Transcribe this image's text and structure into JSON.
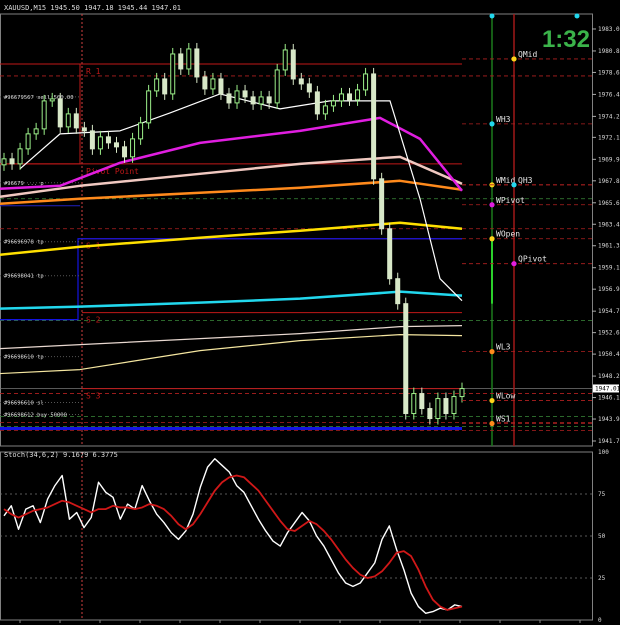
{
  "header": {
    "symbol_label": "XAUUSD,M15  1945.50 1947.18 1945.44 1947.01"
  },
  "timer": "1:32",
  "colors": {
    "up_candle": "#9cf08a",
    "down_candle": "#d8e8c8",
    "white_ma": "#ffffff",
    "magenta_ma": "#e01ee0",
    "pink_ma": "#f0c8c0",
    "orange_ma": "#ff8a1c",
    "yellow_ma": "#ffe000",
    "cyan_ma": "#22d8ee",
    "blue_line": "#1414e0",
    "pivot_red": "#c01818",
    "stoch_main": "#ffffff",
    "stoch_signal": "#d01818"
  },
  "chart_data": [
    {
      "type": "candlestick",
      "title": "XAUUSD,M15",
      "ylim": [
        1941.25,
        1984.5
      ],
      "y_ticks": [
        "1983.00",
        "1980.80",
        "1978.65",
        "1976.45",
        "1974.25",
        "1972.15",
        "1969.95",
        "1967.80",
        "1965.60",
        "1963.45",
        "1961.30",
        "1959.10",
        "1956.95",
        "1954.75",
        "1952.60",
        "1950.45",
        "1948.25",
        "1946.10",
        "1943.95",
        "1941.75"
      ],
      "current_price": "1947.01",
      "candles_close": [
        1970.0,
        1969.5,
        1971.0,
        1972.5,
        1973.0,
        1975.8,
        1976.0,
        1973.2,
        1974.5,
        1973.1,
        1972.8,
        1971.0,
        1972.2,
        1971.6,
        1971.2,
        1970.2,
        1972.0,
        1973.6,
        1976.8,
        1978.0,
        1976.5,
        1980.5,
        1979.0,
        1981.0,
        1978.2,
        1977.0,
        1978.0,
        1976.5,
        1975.6,
        1976.8,
        1976.2,
        1975.5,
        1976.2,
        1975.6,
        1978.9,
        1980.9,
        1978.0,
        1977.5,
        1976.7,
        1974.5,
        1975.3,
        1975.8,
        1976.5,
        1975.9,
        1976.9,
        1978.5,
        1968.0,
        1963.0,
        1958.0,
        1955.5,
        1944.5,
        1946.5,
        1945.0,
        1944.0,
        1946.0,
        1944.5,
        1946.2,
        1947.0
      ],
      "lines": [
        {
          "label": "R 1",
          "value": 1979.5
        },
        {
          "label": "Pivot Point",
          "value": 1969.5
        },
        {
          "label": "S 1",
          "value": 1962.0
        },
        {
          "label": "S 2",
          "value": 1954.6
        },
        {
          "label": "S 3",
          "value": 1947.0
        }
      ],
      "order_labels": [
        {
          "label": "#96679567 sell 500.00",
          "value": 1976.2
        },
        {
          "label": "#96679 ... p",
          "value": 1967.6
        },
        {
          "label": "#96696978 tp",
          "value": 1961.7
        },
        {
          "label": "#96698041 tp",
          "value": 1958.3
        },
        {
          "label": "#96698610 tp",
          "value": 1950.2
        },
        {
          "label": "#96696610 sl",
          "value": 1945.6
        },
        {
          "label": "#96698612 buy 50000",
          "value": 1944.4
        }
      ],
      "weekly_levels": [
        {
          "label": "QMid",
          "value": 1980.0
        },
        {
          "label": "WH3",
          "value": 1973.5
        },
        {
          "label": "WMid",
          "value": 1967.4
        },
        {
          "label": "QH3",
          "value": 1967.4
        },
        {
          "label": "WPivot",
          "value": 1965.4
        },
        {
          "label": "WOpen",
          "value": 1962.0
        },
        {
          "label": "QPivot",
          "value": 1959.5
        },
        {
          "label": "WL3",
          "value": 1950.7
        },
        {
          "label": "WLow",
          "value": 1945.8
        },
        {
          "label": "WS1",
          "value": 1943.5
        }
      ]
    },
    {
      "type": "line",
      "title": "Stoch(34,6,2) 9.1679 6.3775",
      "ylim": [
        0,
        100
      ],
      "y_ticks": [
        "100",
        "75",
        "50",
        "25",
        "0"
      ],
      "series": [
        {
          "values": [
            62,
            68,
            54,
            66,
            68,
            58,
            72,
            80,
            86,
            60,
            64,
            55,
            61,
            82,
            76,
            73,
            60,
            69,
            66,
            80,
            71,
            63,
            58,
            52,
            48,
            53,
            63,
            79,
            91,
            96,
            92,
            88,
            80,
            76,
            68,
            60,
            53,
            47,
            44,
            52,
            58,
            64,
            59,
            50,
            44,
            36,
            28,
            22,
            20,
            22,
            28,
            34,
            48,
            56,
            42,
            30,
            16,
            8,
            4,
            5,
            7,
            6,
            9,
            8
          ]
        },
        {
          "values": [
            66,
            63,
            61,
            63,
            65,
            66,
            67,
            69,
            71,
            70,
            68,
            66,
            64,
            66,
            66,
            68,
            67,
            67,
            66,
            67,
            69,
            68,
            66,
            62,
            57,
            54,
            57,
            63,
            70,
            77,
            82,
            85,
            86,
            85,
            81,
            77,
            71,
            65,
            59,
            54,
            53,
            56,
            59,
            57,
            53,
            48,
            42,
            36,
            31,
            27,
            25,
            26,
            29,
            34,
            40,
            41,
            38,
            30,
            20,
            12,
            8,
            6,
            7,
            8
          ]
        }
      ]
    }
  ]
}
